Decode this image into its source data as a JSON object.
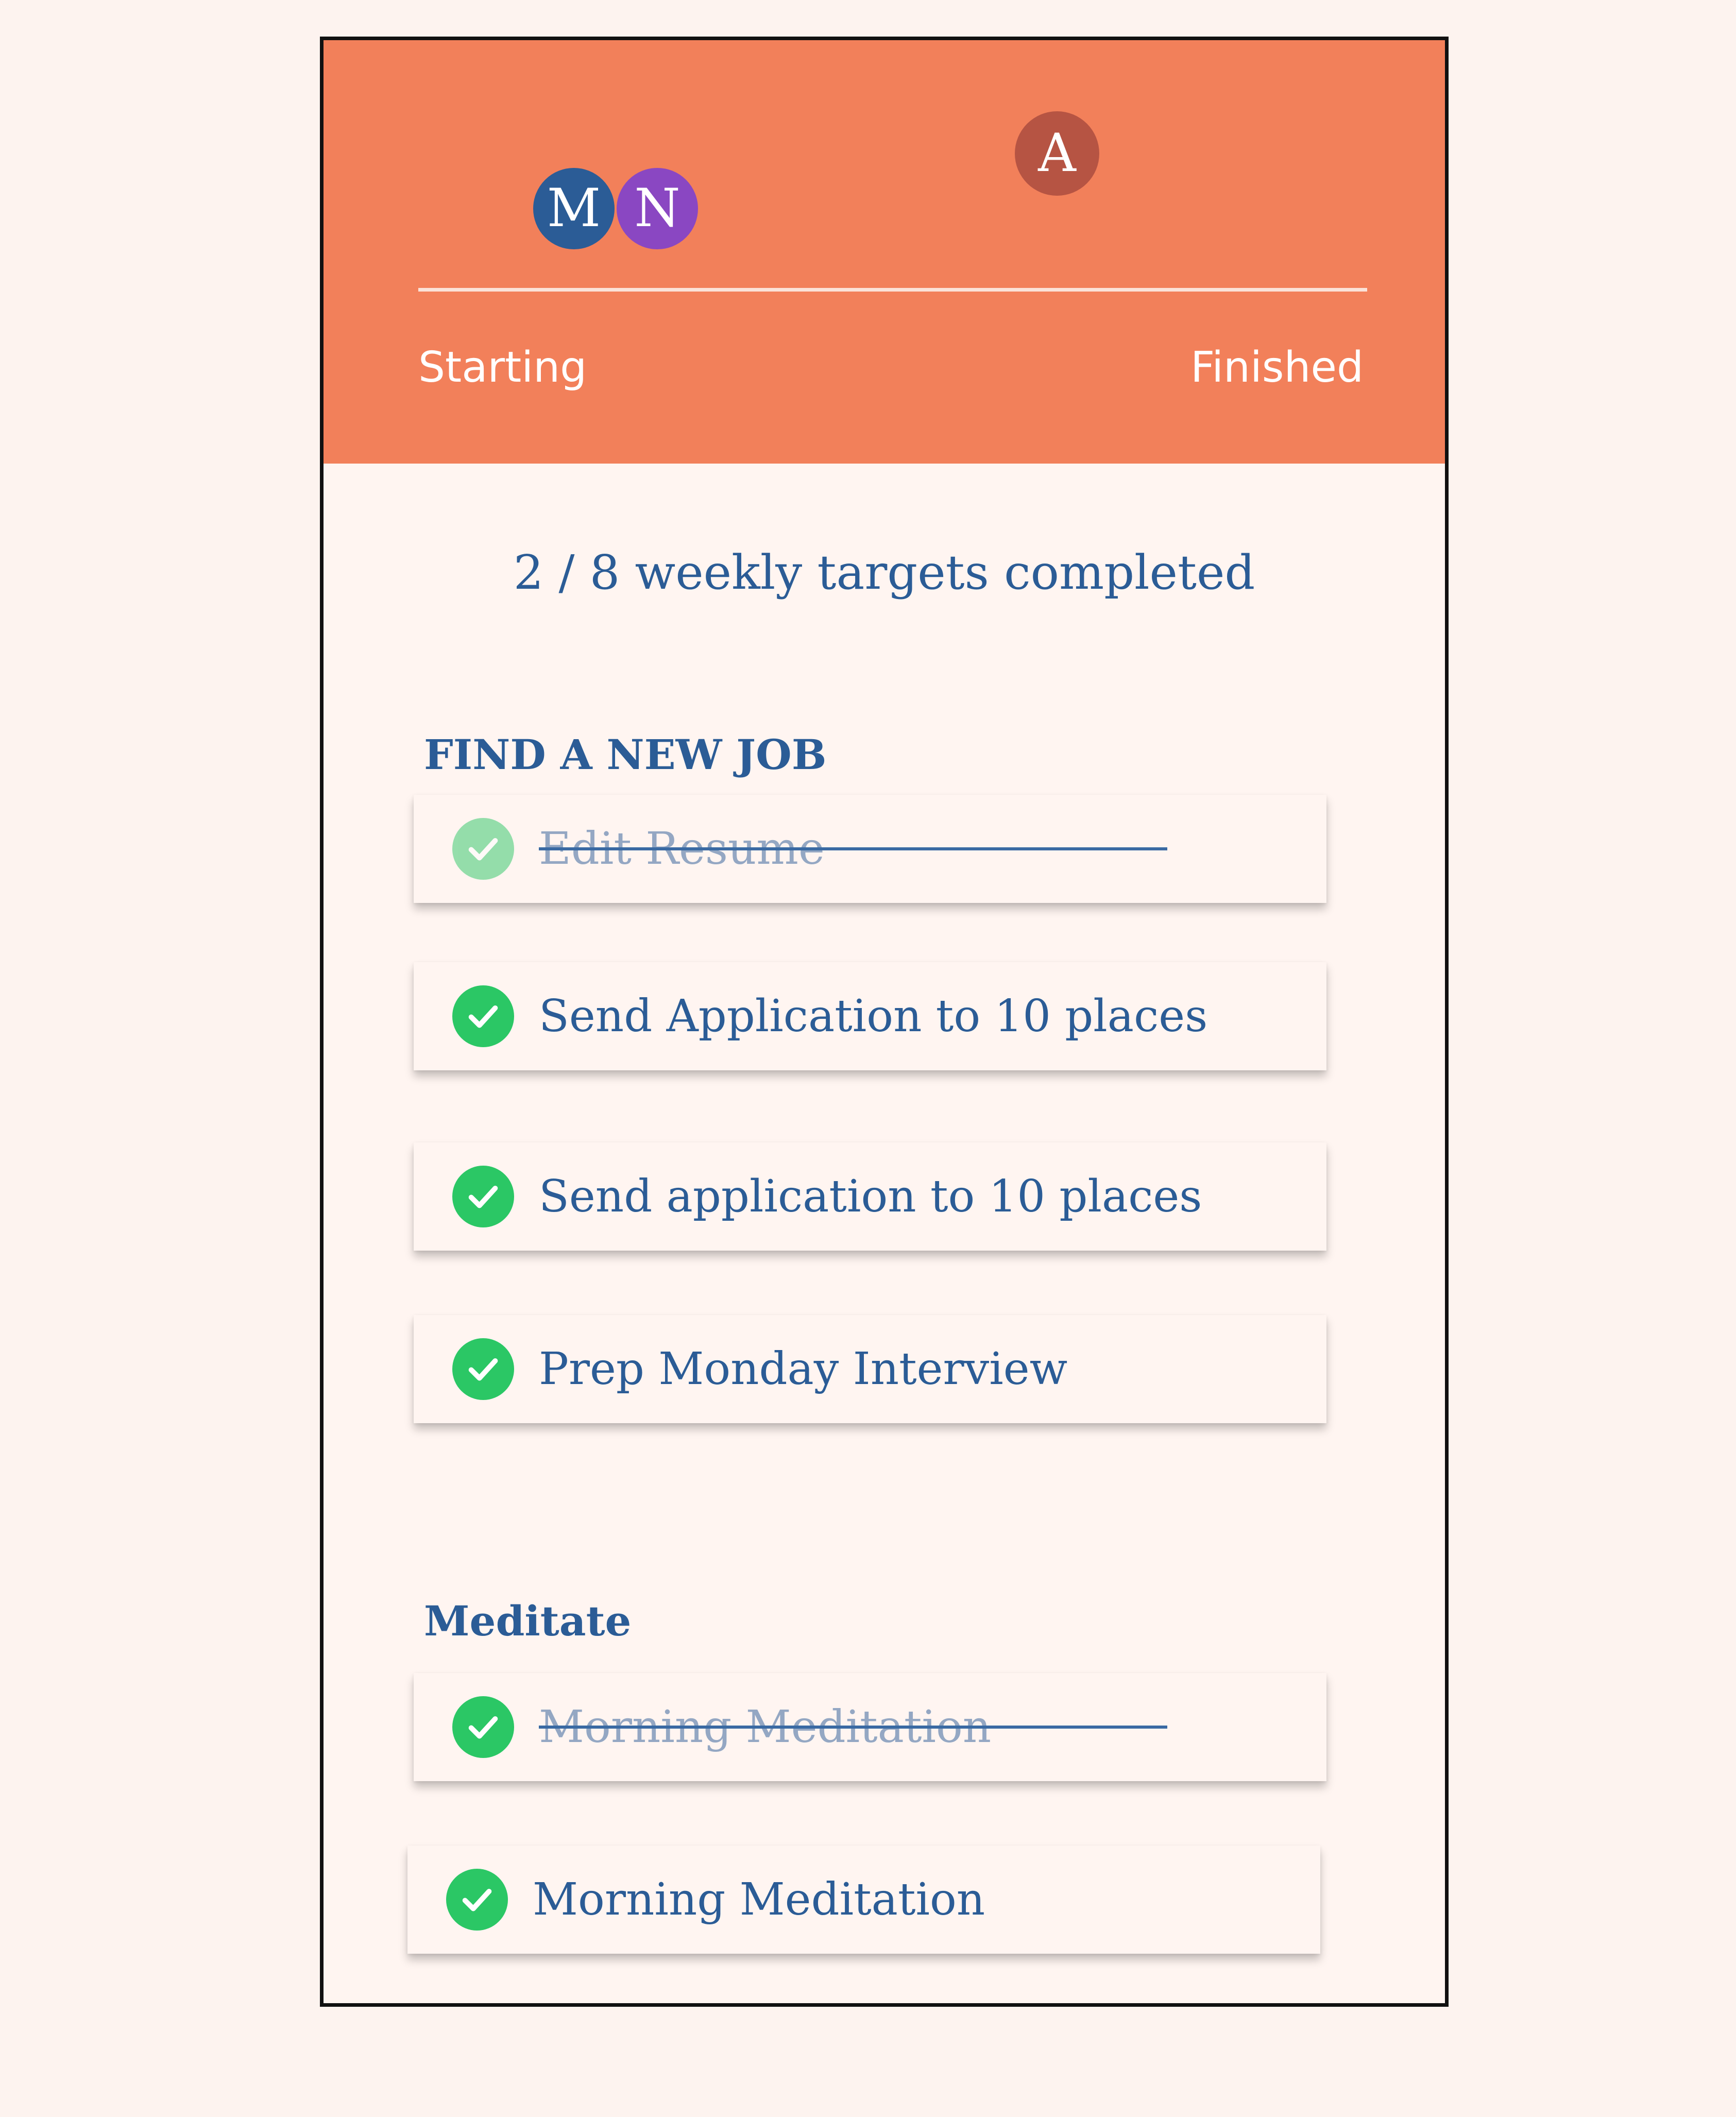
{
  "header": {
    "avatars": [
      {
        "initial": "M",
        "color": "#2b5c96"
      },
      {
        "initial": "N",
        "color": "#8a47c2"
      },
      {
        "initial": "A",
        "color": "#b65443"
      }
    ],
    "progress_start_label": "Starting",
    "progress_end_label": "Finished",
    "accent_color": "#f2805a"
  },
  "summary": "2 / 8 weekly targets completed",
  "sections": [
    {
      "title": "FIND A NEW JOB",
      "tasks": [
        {
          "label": "Edit Resume",
          "completed": true,
          "struck": true
        },
        {
          "label": "Send Application to 10 places",
          "completed": true,
          "struck": false
        },
        {
          "label": "Send application to 10 places",
          "completed": true,
          "struck": false
        },
        {
          "label": "Prep Monday Interview",
          "completed": true,
          "struck": false
        }
      ]
    },
    {
      "title": "Meditate",
      "tasks": [
        {
          "label": "Morning Meditation",
          "completed": true,
          "struck": true
        },
        {
          "label": "Morning Meditation",
          "completed": true,
          "struck": false
        }
      ]
    }
  ],
  "icons": {
    "task_check": "check-circle-icon"
  }
}
